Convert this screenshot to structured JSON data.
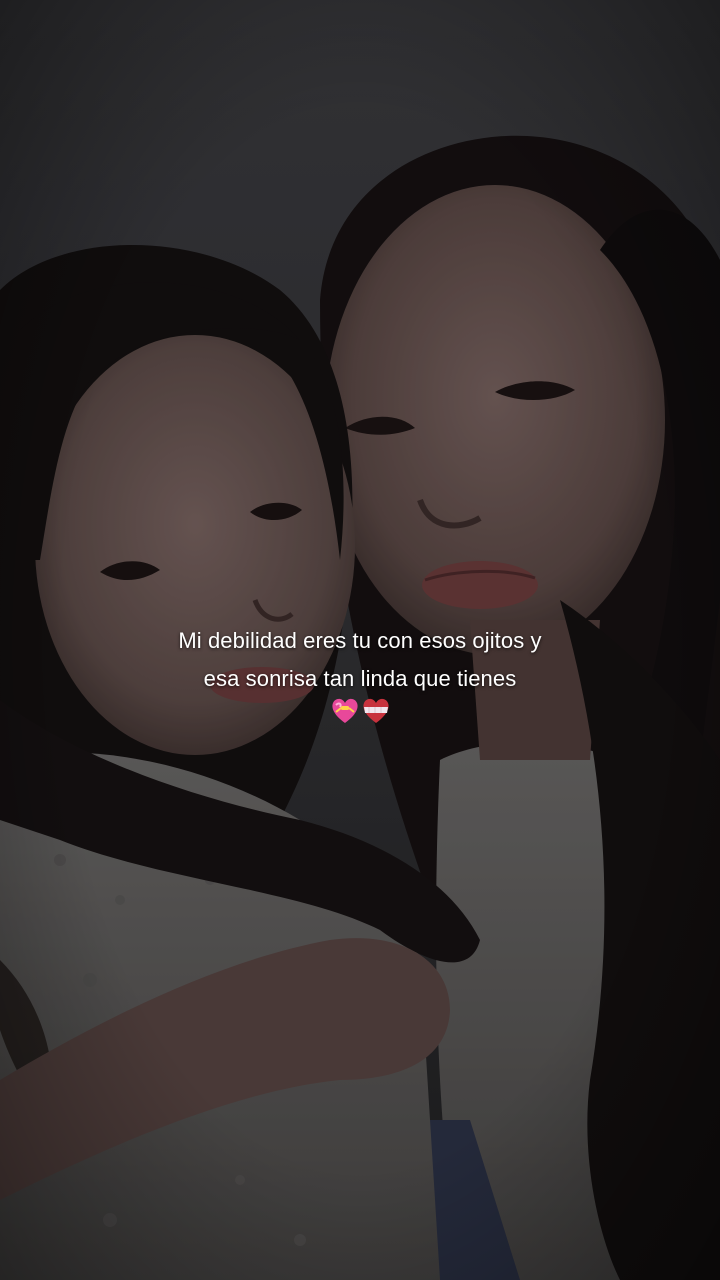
{
  "caption": {
    "line1": "Mi debilidad eres tu con esos ojitos y",
    "line2": "esa sonrisa tan linda que tienes"
  },
  "emojis": [
    "heart-with-ribbon-icon",
    "mending-heart-icon"
  ],
  "colors": {
    "caption_text": "#ffffff",
    "heart_pink": "#e8489a",
    "heart_white": "#f2e6ee",
    "heart_red": "#c8323e",
    "background_wall": "#3a3a3e",
    "hair_dark": "#141010",
    "skin_tone": "#6f5853",
    "shirt_light": "#6a6867"
  }
}
